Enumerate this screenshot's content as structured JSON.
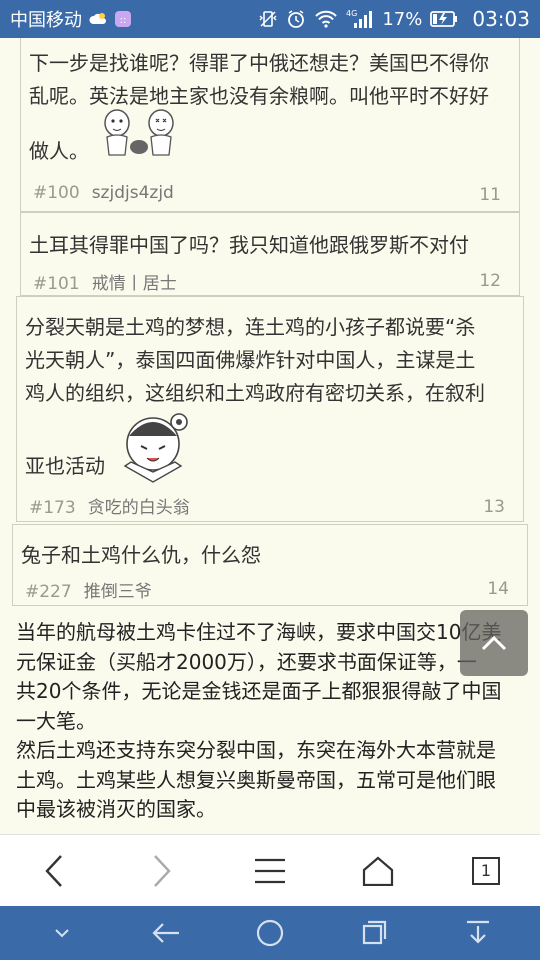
{
  "status_bar": {
    "carrier": "中国移动",
    "network": "4G",
    "battery": "17%",
    "time": "03:03"
  },
  "posts": [
    {
      "text_lines": [
        "下一步是找谁呢？得罪了中俄还想走？美国巴不得你",
        "乱呢。英法是地主家也没有余粮啊。叫他平时不好好",
        "做人。"
      ],
      "pid": "#100",
      "author": "szjdjs4zjd",
      "floor": "11"
    },
    {
      "text_lines": [
        "土耳其得罪中国了吗？我只知道他跟俄罗斯不对付"
      ],
      "pid": "#101",
      "author": "戒情丨居士",
      "floor": "12"
    },
    {
      "text_lines": [
        "分裂天朝是土鸡的梦想，连土鸡的小孩子都说要“杀",
        "光天朝人”，泰国四面佛爆炸针对中国人，主谋是土",
        "鸡人的组织，这组织和土鸡政府有密切关系，在叙利",
        "亚也活动"
      ],
      "pid": "#173",
      "author": "贪吃的白头翁",
      "floor": "13"
    },
    {
      "text_lines": [
        "兔子和土鸡什么仇，什么怨"
      ],
      "pid": "#227",
      "author": "推倒三爷",
      "floor": "14"
    }
  ],
  "long_text_lines": [
    "当年的航母被土鸡卡住过不了海峡，要求中国交10亿美",
    "元保证金（买船才2000万），还要求书面保证等，一",
    "共20个条件，无论是金钱还是面子上都狠狠得敲了中国",
    "一大笔。",
    "然后土鸡还支持东突分裂中国，东突在海外大本营就是",
    "土鸡。土鸡某些人想复兴奥斯曼帝国，五常可是他们眼",
    "中最该被消灭的国家。"
  ],
  "toolbar": {
    "tab_count": "1"
  },
  "colors": {
    "status_bar": "#3a6aa8",
    "page_bg": "#fbfbed",
    "border": "#cfcfbf"
  }
}
